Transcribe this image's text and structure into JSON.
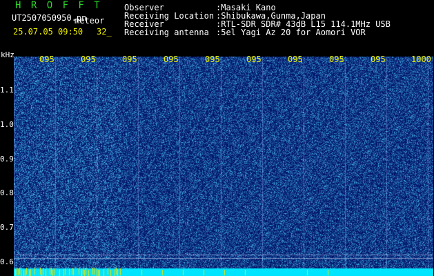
{
  "header": {
    "brand": "H R O F F T",
    "file": "UT2507050950.pn",
    "tag": "meteor",
    "datetime": "25.07.05 09:50",
    "seconds": "32_"
  },
  "info": {
    "observer_label": "Observer",
    "observer_value": ":Masaki Kano",
    "location_label": "Receiving Location",
    "location_value": ":Shibukawa,Gunma,Japan",
    "receiver_label": "Receiver",
    "receiver_value": ":RTL-SDR SDR# 43dB L15 114.1MHz USB",
    "antenna_label": "Receiving antenna",
    "antenna_value": ":5el Yagi Az 20 for Aomori VOR"
  },
  "axis": {
    "unit": "kHz",
    "y_ticks": [
      "1.1",
      "1.0",
      "0.9",
      "0.8",
      "0.7",
      "0.6"
    ],
    "x_ticks": [
      "095",
      "095",
      "095",
      "095",
      "095",
      "095",
      "095",
      "095",
      "095",
      "1000"
    ]
  },
  "colors": {
    "background": "#000000",
    "plot_base": "#0a1b8c",
    "label_green": "#2bd62b",
    "label_yellow": "#f2f200",
    "label_white": "#ffffff",
    "baseline_cyan": "#00e5ff"
  }
}
